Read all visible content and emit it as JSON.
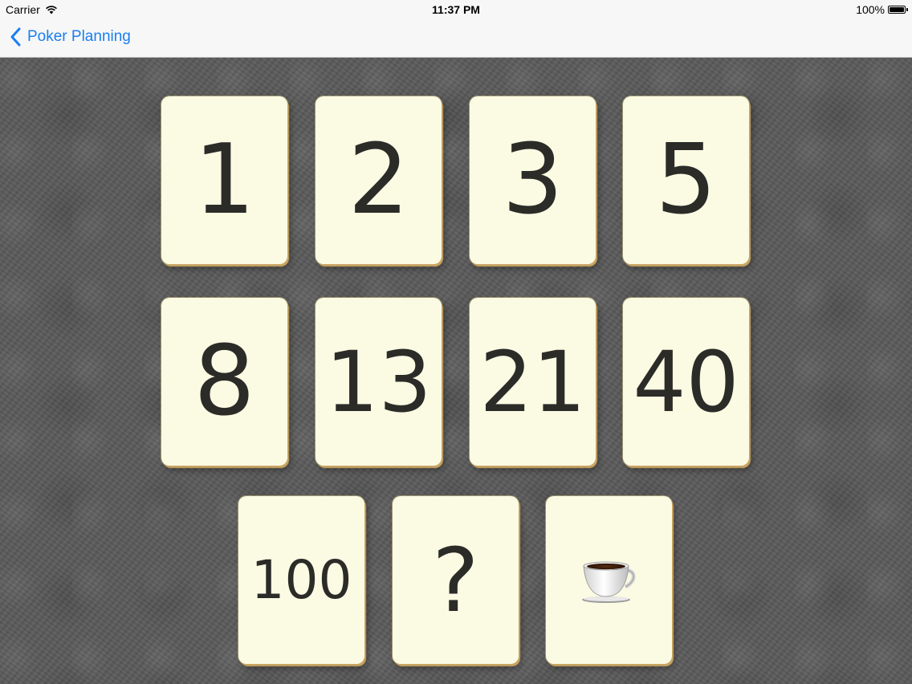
{
  "status_bar": {
    "carrier": "Carrier",
    "time": "11:37 PM",
    "battery": "100%"
  },
  "nav": {
    "back_label": "Poker Planning",
    "accent_color": "#1a7ff0"
  },
  "cards": [
    {
      "label": "1"
    },
    {
      "label": "2"
    },
    {
      "label": "3"
    },
    {
      "label": "5"
    },
    {
      "label": "8"
    },
    {
      "label": "13"
    },
    {
      "label": "21"
    },
    {
      "label": "40"
    },
    {
      "label": "100"
    },
    {
      "label": "?"
    },
    {
      "icon": "coffee-cup-icon"
    }
  ],
  "colors": {
    "card_face": "#fbfae3",
    "card_text": "#2b2b28",
    "table_background": "#5a5a5a"
  }
}
